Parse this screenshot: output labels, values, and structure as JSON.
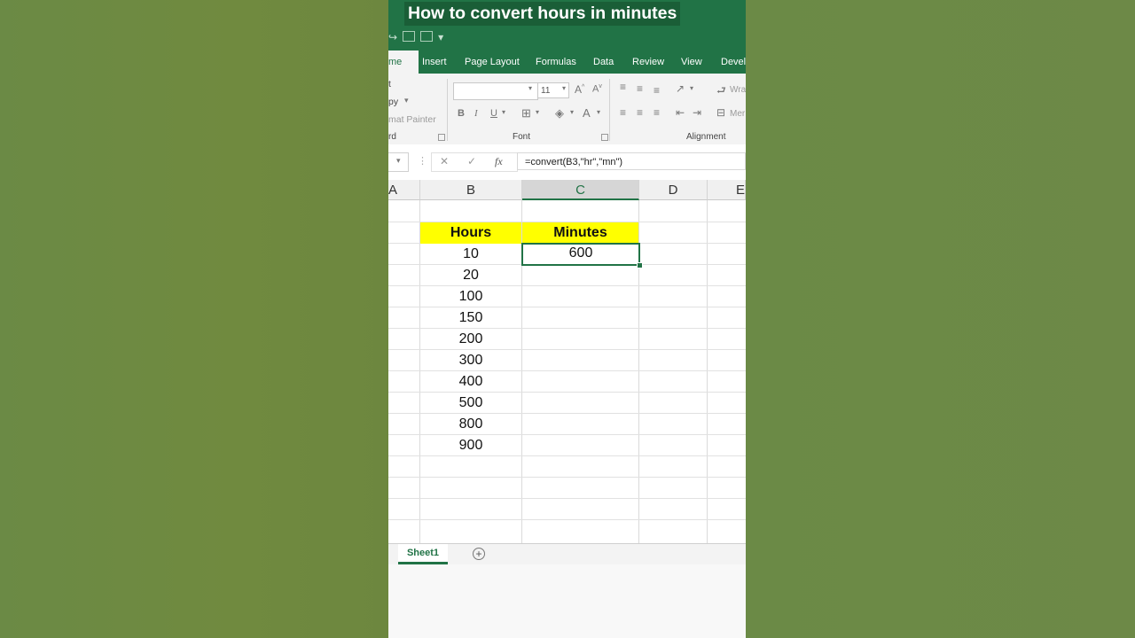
{
  "video_title": "How to convert hours in minutes",
  "tabs": [
    "me",
    "Insert",
    "Page Layout",
    "Formulas",
    "Data",
    "Review",
    "View",
    "Develo"
  ],
  "ribbon": {
    "clipboard_items": [
      "t",
      "py",
      "mat Painter"
    ],
    "clipboard_label": "rd",
    "font_size": "11",
    "font_label": "Font",
    "alignment_label": "Alignment",
    "wrap_text": "Wra",
    "merge": "Mer"
  },
  "formula_bar": {
    "fx": "fx",
    "formula": "=convert(B3,\"hr\",\"mn\")"
  },
  "columns": [
    "A",
    "B",
    "C",
    "D",
    "E"
  ],
  "selected_column": "C",
  "headers": {
    "hours": "Hours",
    "minutes": "Minutes"
  },
  "hours_values": [
    "10",
    "20",
    "100",
    "150",
    "200",
    "300",
    "400",
    "500",
    "800",
    "900"
  ],
  "minutes_values": [
    "600"
  ],
  "sheet_tab": "Sheet1",
  "colors": {
    "excel_green": "#217346",
    "highlight": "#ffff00"
  }
}
